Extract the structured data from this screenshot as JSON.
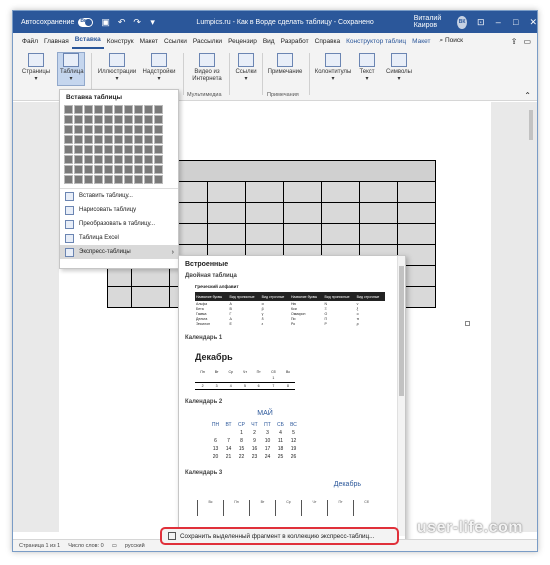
{
  "titlebar": {
    "autosave_label": "Автосохранение",
    "toggle_label": "Вкл",
    "doc_title": "Lumpics.ru - Как в Ворде сделать таблицу - Сохранено",
    "user_name": "Виталий Каиров",
    "user_initials": "ВК"
  },
  "tabs": [
    "Файл",
    "Главная",
    "Вставка",
    "Конструк",
    "Макет",
    "Ссылки",
    "Рассылки",
    "Рецензир",
    "Вид",
    "Разработ",
    "Справка",
    "Конструктор таблиц",
    "Макет"
  ],
  "active_tab": "Вставка",
  "search_label": "Поиск",
  "ribbon": {
    "buttons": [
      "Страницы",
      "Таблица",
      "Иллюстрации",
      "Надстройки",
      "Видео из Интернета",
      "Ссылки",
      "Примечание",
      "Колонтитулы",
      "Текст",
      "Символы"
    ],
    "groups": [
      "Мультимедиа",
      "Примечания"
    ]
  },
  "insert_table": {
    "title": "Вставка таблицы",
    "items": [
      "Вставить таблицу...",
      "Нарисовать таблицу",
      "Преобразовать в таблицу...",
      "Таблица Excel",
      "Экспресс-таблицы"
    ]
  },
  "gallery": {
    "heading": "Встроенные",
    "sections": [
      "Двойная таблица",
      "Календарь 1",
      "Календарь 2",
      "Календарь 3"
    ],
    "double_table": {
      "title": "Греческий алфавит",
      "headers": [
        "Название буквы",
        "Вид прописные",
        "Вид строчные",
        "Название буквы",
        "Вид прописные",
        "Вид строчные"
      ],
      "rows": [
        [
          "Альфа",
          "А",
          "α",
          "Ню",
          "Ν",
          "ν"
        ],
        [
          "Бета",
          "В",
          "β",
          "Кси",
          "Ξ",
          "ξ"
        ],
        [
          "Гамма",
          "Г",
          "γ",
          "Омикрон",
          "О",
          "ο"
        ],
        [
          "Дельта",
          "Δ",
          "δ",
          "Пи",
          "П",
          "π"
        ],
        [
          "Эпсилон",
          "Е",
          "ε",
          "Ро",
          "Р",
          "ρ"
        ]
      ]
    },
    "calendar1": {
      "month": "Декабрь",
      "days": [
        "Пн",
        "Вт",
        "Ср",
        "Чт",
        "Пт",
        "Сб",
        "Вс"
      ],
      "row1": [
        "",
        "",
        "",
        "",
        "",
        "1",
        ""
      ],
      "row2": [
        "2",
        "3",
        "4",
        "5",
        "6",
        "7",
        "8"
      ]
    },
    "calendar2": {
      "month": "МАЙ",
      "days": [
        "ПН",
        "ВТ",
        "СР",
        "ЧТ",
        "ПТ",
        "СБ",
        "ВС"
      ],
      "weeks": [
        [
          "",
          "",
          "1",
          "2",
          "3",
          "4",
          "5"
        ],
        [
          "6",
          "7",
          "8",
          "9",
          "10",
          "11",
          "12"
        ],
        [
          "13",
          "14",
          "15",
          "16",
          "17",
          "18",
          "19"
        ],
        [
          "20",
          "21",
          "22",
          "23",
          "24",
          "25",
          "26"
        ]
      ]
    },
    "calendar3": {
      "month": "Декабрь",
      "days": [
        "Вс",
        "Пн",
        "Вт",
        "Ср",
        "Чт",
        "Пт",
        "Сб"
      ]
    }
  },
  "save_selection_label": "Сохранить выделенный фрагмент в коллекцию экспресс-таблиц...",
  "status": {
    "page": "Страница 1 из 1",
    "words": "Число слов: 0",
    "lang": "русский"
  },
  "watermark": "user-life.com"
}
